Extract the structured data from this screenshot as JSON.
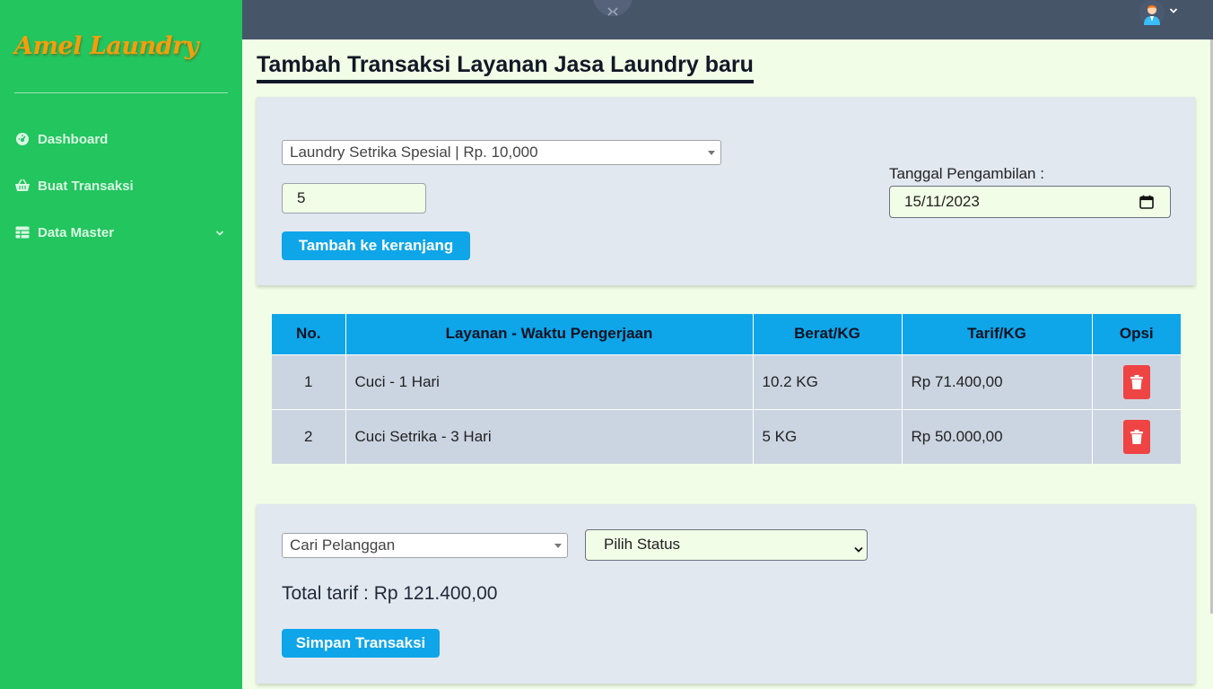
{
  "sidebar": {
    "brand": "Amel Laundry",
    "items": [
      {
        "label": "Dashboard",
        "icon": "dashboard-icon"
      },
      {
        "label": "Buat Transaksi",
        "icon": "basket-icon"
      },
      {
        "label": "Data Master",
        "icon": "table-icon"
      }
    ]
  },
  "topbar": {
    "icons": [
      "sidebar-toggle-icon",
      "user-avatar-icon",
      "chevron-down-icon"
    ]
  },
  "page": {
    "title": "Tambah Transaksi Layanan Jasa Laundry baru"
  },
  "form": {
    "service_select": "Laundry Setrika Spesial | Rp. 10,000",
    "weight_value": "5",
    "add_button": "Tambah ke keranjang",
    "pickup_label": "Tanggal Pengambilan :",
    "pickup_date": "15/11/2023"
  },
  "table": {
    "headers": [
      "No.",
      "Layanan - Waktu Pengerjaan",
      "Berat/KG",
      "Tarif/KG",
      "Opsi"
    ],
    "rows": [
      {
        "no": "1",
        "service": "Cuci - 1 Hari",
        "weight": "10.2 KG",
        "price": "Rp 71.400,00"
      },
      {
        "no": "2",
        "service": "Cuci Setrika - 3 Hari",
        "weight": "5 KG",
        "price": "Rp 50.000,00"
      }
    ]
  },
  "checkout": {
    "customer_select": "Cari Pelanggan",
    "status_select": "Pilih Status",
    "total": "Total tarif : Rp 121.400,00",
    "save_button": "Simpan Transaksi"
  },
  "colors": {
    "sidebar": "#22c55e",
    "topbar": "#475569",
    "accent": "#0ea5e9",
    "danger": "#ef4444",
    "brand": "#f59e0b"
  }
}
